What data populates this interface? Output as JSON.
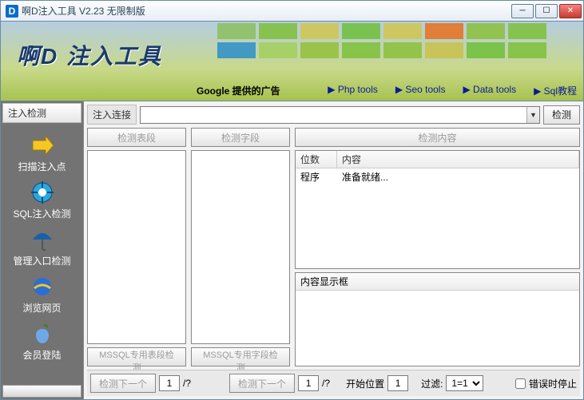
{
  "titlebar": {
    "app_icon": "D",
    "title": "啊D注入工具 V2.23 无限制版"
  },
  "banner": {
    "brand": "啊D 注入工具",
    "sponsor": "Google 提供的广告",
    "links": [
      "▶  Php tools",
      "▶  Seo tools",
      "▶  Data tools",
      "▶  Sql教程"
    ],
    "block_colors": [
      "#8bbf5d",
      "#7ebf3a",
      "#d0c64d",
      "#6ec03a",
      "#d0c64d",
      "#e8701e",
      "#8bbf3a",
      "#7ebf3a",
      "#2c8fc8",
      "#a2cf5d",
      "#93bf3a",
      "#7ebf3a",
      "#8bbf3a",
      "#c9c14d",
      "#6ec03a",
      "#7ebf3a"
    ]
  },
  "sidebar": {
    "header": "注入检测",
    "items": [
      {
        "label": "扫描注入点"
      },
      {
        "label": "SQL注入检测"
      },
      {
        "label": "管理入口检测"
      },
      {
        "label": "浏览网页"
      },
      {
        "label": "会员登陆"
      }
    ]
  },
  "main": {
    "conn_label": "注入连接",
    "conn_value": "",
    "detect_btn": "检测",
    "btn_table": "检测表段",
    "btn_field": "检测字段",
    "btn_content": "检测内容",
    "grid": {
      "col1": "位数",
      "col2": "内容",
      "row_c1": "程序",
      "row_c2": "准备就绪..."
    },
    "display_header": "内容显示框",
    "btn_mssql_table": "MSSQL专用表段检测",
    "btn_mssql_field": "MSSQL专用字段检测"
  },
  "bottom": {
    "btn_next": "检测下一个",
    "v1": "1",
    "slash": "/?",
    "v2": "/?",
    "start_label": "开始位置",
    "start_value": "1",
    "filter_label": "过滤:",
    "filter_value": "1=1",
    "err_stop": "错误时停止",
    "start_btn": "开始位置"
  }
}
